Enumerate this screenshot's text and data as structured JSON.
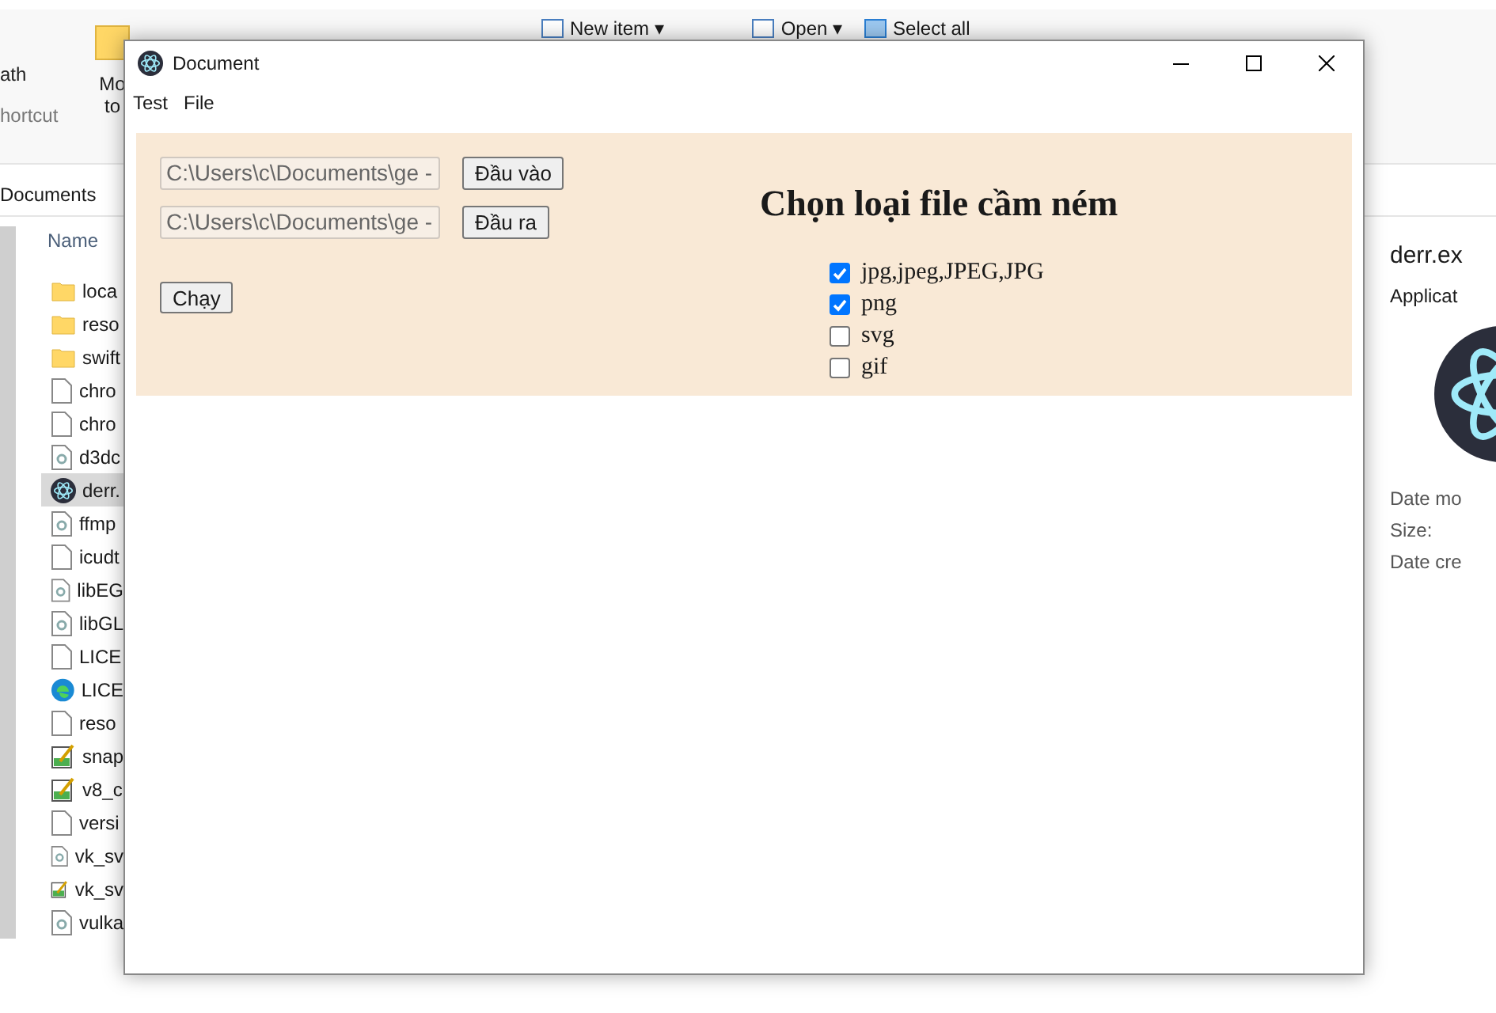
{
  "explorer": {
    "ribbon": {
      "left_labels": [
        "ath",
        "hortcut"
      ],
      "move_labels": [
        "Mo",
        "to"
      ],
      "new_item": "New item ▾",
      "open": "Open ▾",
      "select_all": "Select all"
    },
    "breadcrumb": "Documents",
    "files": {
      "header": "Name",
      "rows": [
        {
          "name": "loca",
          "kind": "folder",
          "selected": false
        },
        {
          "name": "reso",
          "kind": "folder",
          "selected": false
        },
        {
          "name": "swift",
          "kind": "folder",
          "selected": false
        },
        {
          "name": "chro",
          "kind": "file",
          "selected": false
        },
        {
          "name": "chro",
          "kind": "file",
          "selected": false
        },
        {
          "name": "d3dc",
          "kind": "library",
          "selected": false
        },
        {
          "name": "derr.",
          "kind": "app",
          "selected": true
        },
        {
          "name": "ffmp",
          "kind": "library",
          "selected": false
        },
        {
          "name": "icudt",
          "kind": "file",
          "selected": false
        },
        {
          "name": "libEG",
          "kind": "library",
          "selected": false
        },
        {
          "name": "libGL",
          "kind": "library",
          "selected": false
        },
        {
          "name": "LICE",
          "kind": "file",
          "selected": false
        },
        {
          "name": "LICE",
          "kind": "browser",
          "selected": false
        },
        {
          "name": "reso",
          "kind": "file",
          "selected": false
        },
        {
          "name": "snap",
          "kind": "notepad",
          "selected": false
        },
        {
          "name": "v8_c",
          "kind": "notepad",
          "selected": false
        },
        {
          "name": "versi",
          "kind": "file",
          "selected": false
        },
        {
          "name": "vk_sv",
          "kind": "library",
          "selected": false
        },
        {
          "name": "vk_sv",
          "kind": "notepad",
          "selected": false
        },
        {
          "name": "vulka",
          "kind": "library",
          "selected": false
        }
      ]
    },
    "details": {
      "title": "derr.ex",
      "type": "Applicat",
      "fields": [
        "Date mo",
        "Size:",
        "Date cre"
      ]
    }
  },
  "document_window": {
    "title": "Document",
    "menu": [
      "Test",
      "File"
    ],
    "paths": [
      {
        "value": "C:\\Users\\c\\Documents\\ge -",
        "button": "Đầu vào"
      },
      {
        "value": "C:\\Users\\c\\Documents\\ge -",
        "button": "Đầu ra"
      }
    ],
    "run_button": "Chạy",
    "heading": "Chọn loại file cầm ném",
    "options": [
      {
        "label": "jpg,jpeg,JPEG,JPG",
        "checked": true
      },
      {
        "label": "png",
        "checked": true
      },
      {
        "label": "svg",
        "checked": false
      },
      {
        "label": "gif",
        "checked": false
      }
    ]
  }
}
